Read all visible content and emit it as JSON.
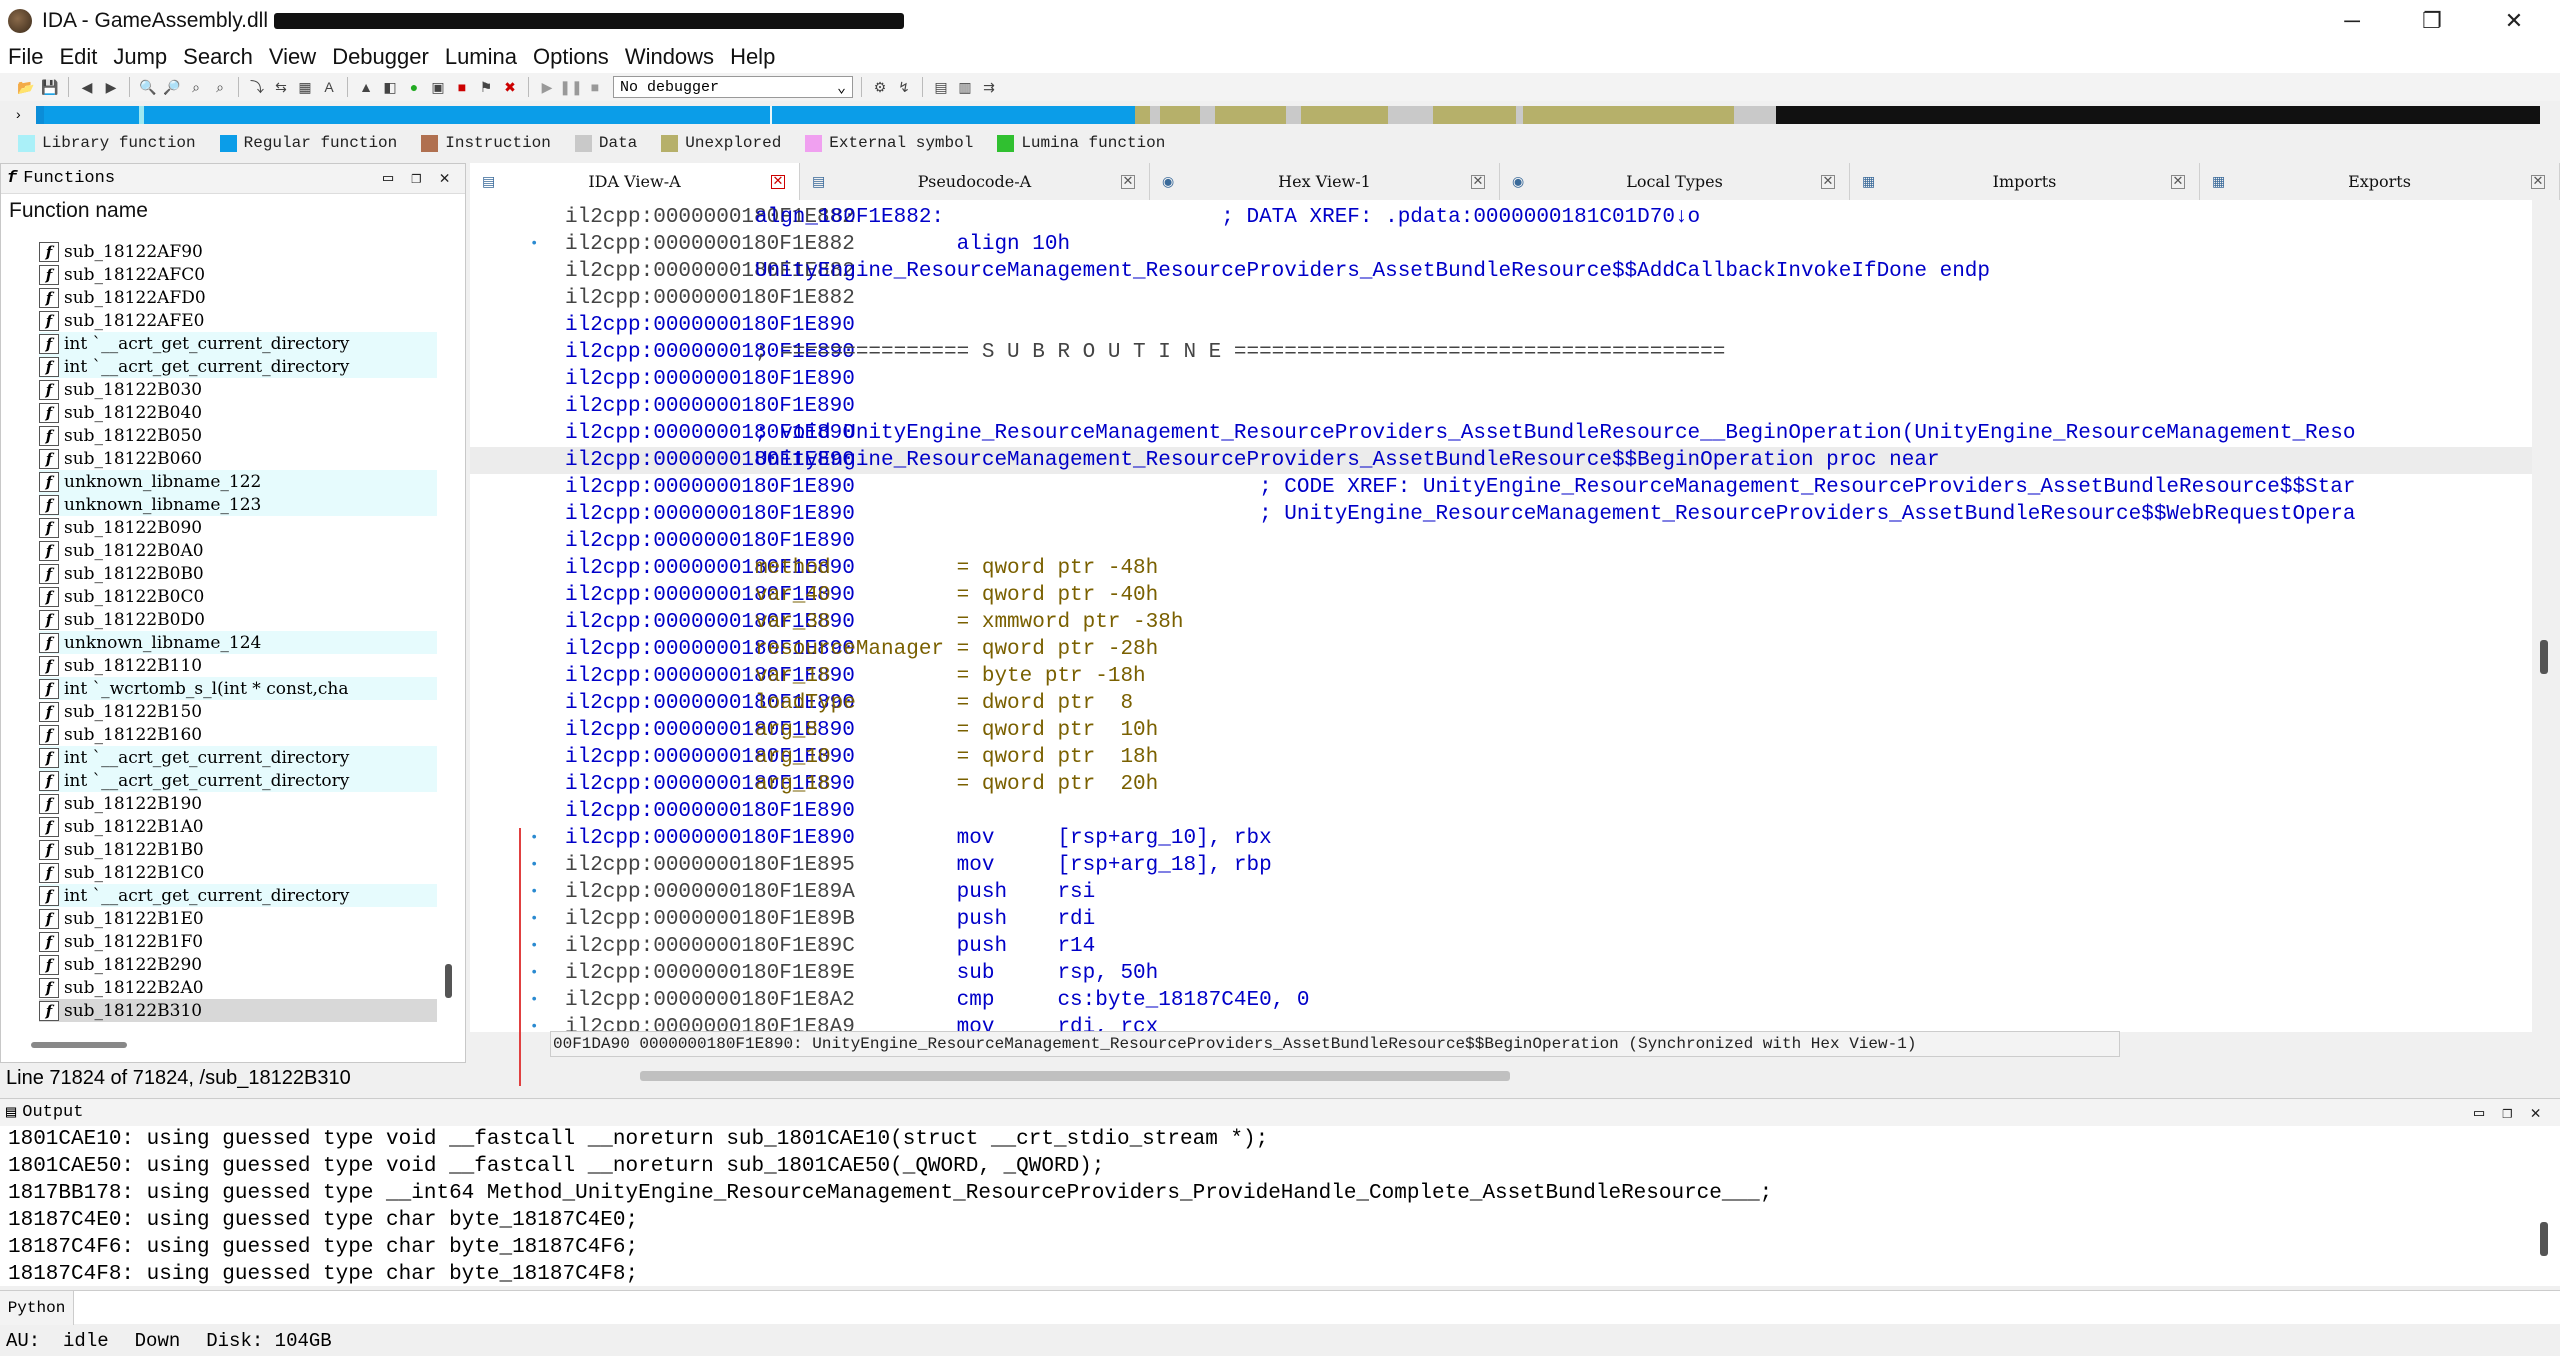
{
  "window": {
    "title": "IDA - GameAssembly.dll"
  },
  "menu": [
    "File",
    "Edit",
    "Jump",
    "Search",
    "View",
    "Debugger",
    "Lumina",
    "Options",
    "Windows",
    "Help"
  ],
  "toolbar": {
    "debugger_value": "No debugger"
  },
  "navband": {
    "segments": [
      {
        "kind": "library",
        "color": "#0b8dd8",
        "frac": 0.003
      },
      {
        "kind": "regular",
        "color": "#0b9de8",
        "frac": 0.038
      },
      {
        "kind": "library",
        "color": "#9ee8f0",
        "frac": 0.002
      },
      {
        "kind": "regular",
        "color": "#0b9de8",
        "frac": 0.25
      },
      {
        "kind": "marker",
        "color": "#e8f6f8",
        "frac": 0.001
      },
      {
        "kind": "regular",
        "color": "#0b9de8",
        "frac": 0.145
      },
      {
        "kind": "unexplored",
        "color": "#b6b06a",
        "frac": 0.006
      },
      {
        "kind": "data",
        "color": "#c9c9c9",
        "frac": 0.004
      },
      {
        "kind": "unexplored",
        "color": "#b6b06a",
        "frac": 0.016
      },
      {
        "kind": "data",
        "color": "#c9c9c9",
        "frac": 0.006
      },
      {
        "kind": "unexplored",
        "color": "#b6b06a",
        "frac": 0.028
      },
      {
        "kind": "data",
        "color": "#c9c9c9",
        "frac": 0.006
      },
      {
        "kind": "unexplored",
        "color": "#b6b06a",
        "frac": 0.035
      },
      {
        "kind": "data",
        "color": "#c9c9c9",
        "frac": 0.018
      },
      {
        "kind": "unexplored",
        "color": "#b6b06a",
        "frac": 0.033
      },
      {
        "kind": "data",
        "color": "#c9c9c9",
        "frac": 0.003
      },
      {
        "kind": "unexplored",
        "color": "#b6b06a",
        "frac": 0.084
      },
      {
        "kind": "data",
        "color": "#c9c9c9",
        "frac": 0.017
      },
      {
        "kind": "external",
        "color": "#111111",
        "frac": 0.305
      }
    ]
  },
  "legend": [
    {
      "label": "Library function",
      "color": "#aaf0f8"
    },
    {
      "label": "Regular function",
      "color": "#0b9de8"
    },
    {
      "label": "Instruction",
      "color": "#b07050"
    },
    {
      "label": "Data",
      "color": "#c9c9c9"
    },
    {
      "label": "Unexplored",
      "color": "#b6b06a"
    },
    {
      "label": "External symbol",
      "color": "#f0a0f0"
    },
    {
      "label": "Lumina function",
      "color": "#30c030"
    }
  ],
  "functions_panel": {
    "title": "Functions",
    "column_header": "Function name",
    "rows": [
      {
        "name": "sub_18122AF90",
        "lib": false
      },
      {
        "name": "sub_18122AFC0",
        "lib": false
      },
      {
        "name": "sub_18122AFD0",
        "lib": false
      },
      {
        "name": "sub_18122AFE0",
        "lib": false
      },
      {
        "name": "int `__acrt_get_current_directory",
        "lib": true
      },
      {
        "name": "int `__acrt_get_current_directory",
        "lib": true
      },
      {
        "name": "sub_18122B030",
        "lib": false
      },
      {
        "name": "sub_18122B040",
        "lib": false
      },
      {
        "name": "sub_18122B050",
        "lib": false
      },
      {
        "name": "sub_18122B060",
        "lib": false
      },
      {
        "name": "unknown_libname_122",
        "lib": true
      },
      {
        "name": "unknown_libname_123",
        "lib": true
      },
      {
        "name": "sub_18122B090",
        "lib": false
      },
      {
        "name": "sub_18122B0A0",
        "lib": false
      },
      {
        "name": "sub_18122B0B0",
        "lib": false
      },
      {
        "name": "sub_18122B0C0",
        "lib": false
      },
      {
        "name": "sub_18122B0D0",
        "lib": false
      },
      {
        "name": "unknown_libname_124",
        "lib": true
      },
      {
        "name": "sub_18122B110",
        "lib": false
      },
      {
        "name": "int `_wcrtomb_s_l(int * const,cha",
        "lib": true
      },
      {
        "name": "sub_18122B150",
        "lib": false
      },
      {
        "name": "sub_18122B160",
        "lib": false
      },
      {
        "name": "int `__acrt_get_current_directory",
        "lib": true
      },
      {
        "name": "int `__acrt_get_current_directory",
        "lib": true
      },
      {
        "name": "sub_18122B190",
        "lib": false
      },
      {
        "name": "sub_18122B1A0",
        "lib": false
      },
      {
        "name": "sub_18122B1B0",
        "lib": false
      },
      {
        "name": "sub_18122B1C0",
        "lib": false
      },
      {
        "name": "int `__acrt_get_current_directory",
        "lib": true
      },
      {
        "name": "sub_18122B1E0",
        "lib": false
      },
      {
        "name": "sub_18122B1F0",
        "lib": false
      },
      {
        "name": "sub_18122B290",
        "lib": false
      },
      {
        "name": "sub_18122B2A0",
        "lib": false
      },
      {
        "name": "sub_18122B310",
        "lib": false,
        "selected": true
      }
    ],
    "status": "Line 71824 of 71824, /sub_18122B310"
  },
  "tabs": [
    {
      "label": "IDA View-A",
      "active": true
    },
    {
      "label": "Pseudocode-A",
      "active": false
    },
    {
      "label": "Hex View-1",
      "active": false
    },
    {
      "label": "Local Types",
      "active": false
    },
    {
      "label": "Imports",
      "active": false
    },
    {
      "label": "Exports",
      "active": false
    }
  ],
  "listing": [
    {
      "addr": "il2cpp:0000000180F1E882",
      "blue": false,
      "text": "algn_180F1E882:                      ; DATA XREF: .pdata:0000000181C01D70↓o"
    },
    {
      "addr": "il2cpp:0000000180F1E882",
      "blue": false,
      "text": "                align 10h",
      "dot": true
    },
    {
      "addr": "il2cpp:0000000180F1E882",
      "blue": false,
      "text": "UnityEngine_ResourceManagement_ResourceProviders_AssetBundleResource$$AddCallbackInvokeIfDone endp"
    },
    {
      "addr": "il2cpp:0000000180F1E882",
      "blue": false,
      "text": ""
    },
    {
      "addr": "il2cpp:0000000180F1E890",
      "blue": true,
      "text": ""
    },
    {
      "addr": "il2cpp:0000000180F1E890",
      "blue": true,
      "text": "; =============== S U B R O U T I N E ======================================="
    },
    {
      "addr": "il2cpp:0000000180F1E890",
      "blue": true,
      "text": ""
    },
    {
      "addr": "il2cpp:0000000180F1E890",
      "blue": true,
      "text": ""
    },
    {
      "addr": "il2cpp:0000000180F1E890",
      "blue": true,
      "text": "; void UnityEngine_ResourceManagement_ResourceProviders_AssetBundleResource__BeginOperation(UnityEngine_ResourceManagement_Reso"
    },
    {
      "addr": "il2cpp:0000000180F1E890",
      "blue": true,
      "text": "UnityEngine_ResourceManagement_ResourceProviders_AssetBundleResource$$BeginOperation proc near",
      "current": true
    },
    {
      "addr": "il2cpp:0000000180F1E890",
      "blue": true,
      "text": "                                        ; CODE XREF: UnityEngine_ResourceManagement_ResourceProviders_AssetBundleResource$$Star"
    },
    {
      "addr": "il2cpp:0000000180F1E890",
      "blue": true,
      "text": "                                        ; UnityEngine_ResourceManagement_ResourceProviders_AssetBundleResource$$WebRequestOpera"
    },
    {
      "addr": "il2cpp:0000000180F1E890",
      "blue": true,
      "text": ""
    },
    {
      "addr": "il2cpp:0000000180F1E890",
      "blue": true,
      "text": "method          = qword ptr -48h",
      "var": true
    },
    {
      "addr": "il2cpp:0000000180F1E890",
      "blue": true,
      "text": "var_40          = qword ptr -40h",
      "var": true
    },
    {
      "addr": "il2cpp:0000000180F1E890",
      "blue": true,
      "text": "var_38          = xmmword ptr -38h",
      "var": true
    },
    {
      "addr": "il2cpp:0000000180F1E890",
      "blue": true,
      "text": "resourceManager = qword ptr -28h",
      "var": true
    },
    {
      "addr": "il2cpp:0000000180F1E890",
      "blue": true,
      "text": "var_18          = byte ptr -18h",
      "var": true
    },
    {
      "addr": "il2cpp:0000000180F1E890",
      "blue": true,
      "text": "loadType        = dword ptr  8",
      "var": true
    },
    {
      "addr": "il2cpp:0000000180F1E890",
      "blue": true,
      "text": "arg_8           = qword ptr  10h",
      "var": true
    },
    {
      "addr": "il2cpp:0000000180F1E890",
      "blue": true,
      "text": "arg_10          = qword ptr  18h",
      "var": true
    },
    {
      "addr": "il2cpp:0000000180F1E890",
      "blue": true,
      "text": "arg_18          = qword ptr  20h",
      "var": true
    },
    {
      "addr": "il2cpp:0000000180F1E890",
      "blue": true,
      "text": ""
    },
    {
      "addr": "il2cpp:0000000180F1E890",
      "blue": true,
      "text": "                mov     [rsp+arg_10], rbx",
      "dot": true
    },
    {
      "addr": "il2cpp:0000000180F1E895",
      "blue": false,
      "text": "                mov     [rsp+arg_18], rbp",
      "dot": true
    },
    {
      "addr": "il2cpp:0000000180F1E89A",
      "blue": false,
      "text": "                push    rsi",
      "dot": true
    },
    {
      "addr": "il2cpp:0000000180F1E89B",
      "blue": false,
      "text": "                push    rdi",
      "dot": true
    },
    {
      "addr": "il2cpp:0000000180F1E89C",
      "blue": false,
      "text": "                push    r14",
      "dot": true
    },
    {
      "addr": "il2cpp:0000000180F1E89E",
      "blue": false,
      "text": "                sub     rsp, 50h",
      "dot": true
    },
    {
      "addr": "il2cpp:0000000180F1E8A2",
      "blue": false,
      "text": "                cmp     cs:byte_18187C4E0, 0",
      "dot": true
    },
    {
      "addr": "il2cpp:0000000180F1E8A9",
      "blue": false,
      "text": "                mov     rdi, rcx",
      "dot": true
    }
  ],
  "listing_info": "00F1DA90 0000000180F1E890: UnityEngine_ResourceManagement_ResourceProviders_AssetBundleResource$$BeginOperation (Synchronized with Hex View-1)",
  "output_panel": {
    "title": "Output",
    "lines": [
      "1801CAE10: using guessed type void __fastcall __noreturn sub_1801CAE10(struct __crt_stdio_stream *);",
      "1801CAE50: using guessed type void __fastcall __noreturn sub_1801CAE50(_QWORD, _QWORD);",
      "1817BB178: using guessed type __int64 Method_UnityEngine_ResourceManagement_ResourceProviders_ProvideHandle_Complete_AssetBundleResource___;",
      "18187C4E0: using guessed type char byte_18187C4E0;",
      "18187C4F6: using guessed type char byte_18187C4F6;",
      "18187C4F8: using guessed type char byte_18187C4F8;"
    ]
  },
  "python_label": "Python",
  "status": {
    "au_label": "AU:",
    "au_value": "idle",
    "direction": "Down",
    "disk": "Disk: 104GB"
  }
}
